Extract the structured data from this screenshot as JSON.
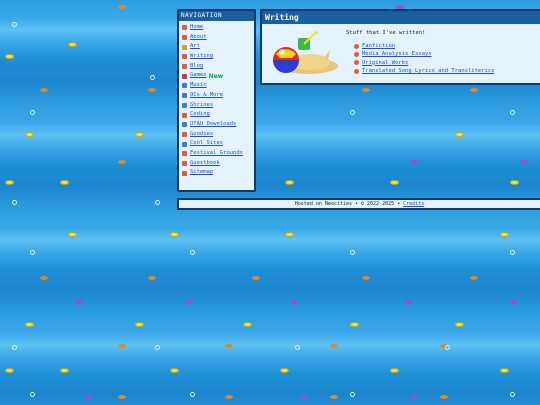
{
  "nav": {
    "heading": "NAVIGATION",
    "items": [
      {
        "label": "Home",
        "color": "#e25a3a"
      },
      {
        "label": "About",
        "color": "#e25a3a"
      },
      {
        "label": "Art",
        "color": "#d8a020"
      },
      {
        "label": "Writing",
        "color": "#e25a3a"
      },
      {
        "label": "Blog",
        "color": "#e25a3a"
      },
      {
        "label": "Games",
        "color": "#c04040"
      },
      {
        "label": "Music",
        "color": "#3a7ad8"
      },
      {
        "label": "OCs & More",
        "color": "#3a7ad8"
      },
      {
        "label": "Shrines",
        "color": "#3a7ad8"
      },
      {
        "label": "Coding",
        "color": "#e25a3a"
      },
      {
        "label": "UTAU Downloads",
        "color": "#3a7ad8"
      },
      {
        "label": "Goodies",
        "color": "#e25a3a"
      },
      {
        "label": "Cool Sites",
        "color": "#3a7ad8"
      },
      {
        "label": "Festival Grounds",
        "color": "#e25a3a"
      },
      {
        "label": "Guestbook",
        "color": "#e25a3a"
      },
      {
        "label": "Sitemap",
        "color": "#e25a3a"
      }
    ],
    "new_badge": "New"
  },
  "main": {
    "title": "Writing",
    "intro": "Stuff that I've written!",
    "links": [
      "Fanfiction",
      "Media Analysis Essays",
      "Original Works",
      "Translated Song Lyrics and Transliterics"
    ]
  },
  "footer": {
    "text": "Hosted on Neocities • © 2022-2025 • ",
    "credits": "Credits"
  }
}
